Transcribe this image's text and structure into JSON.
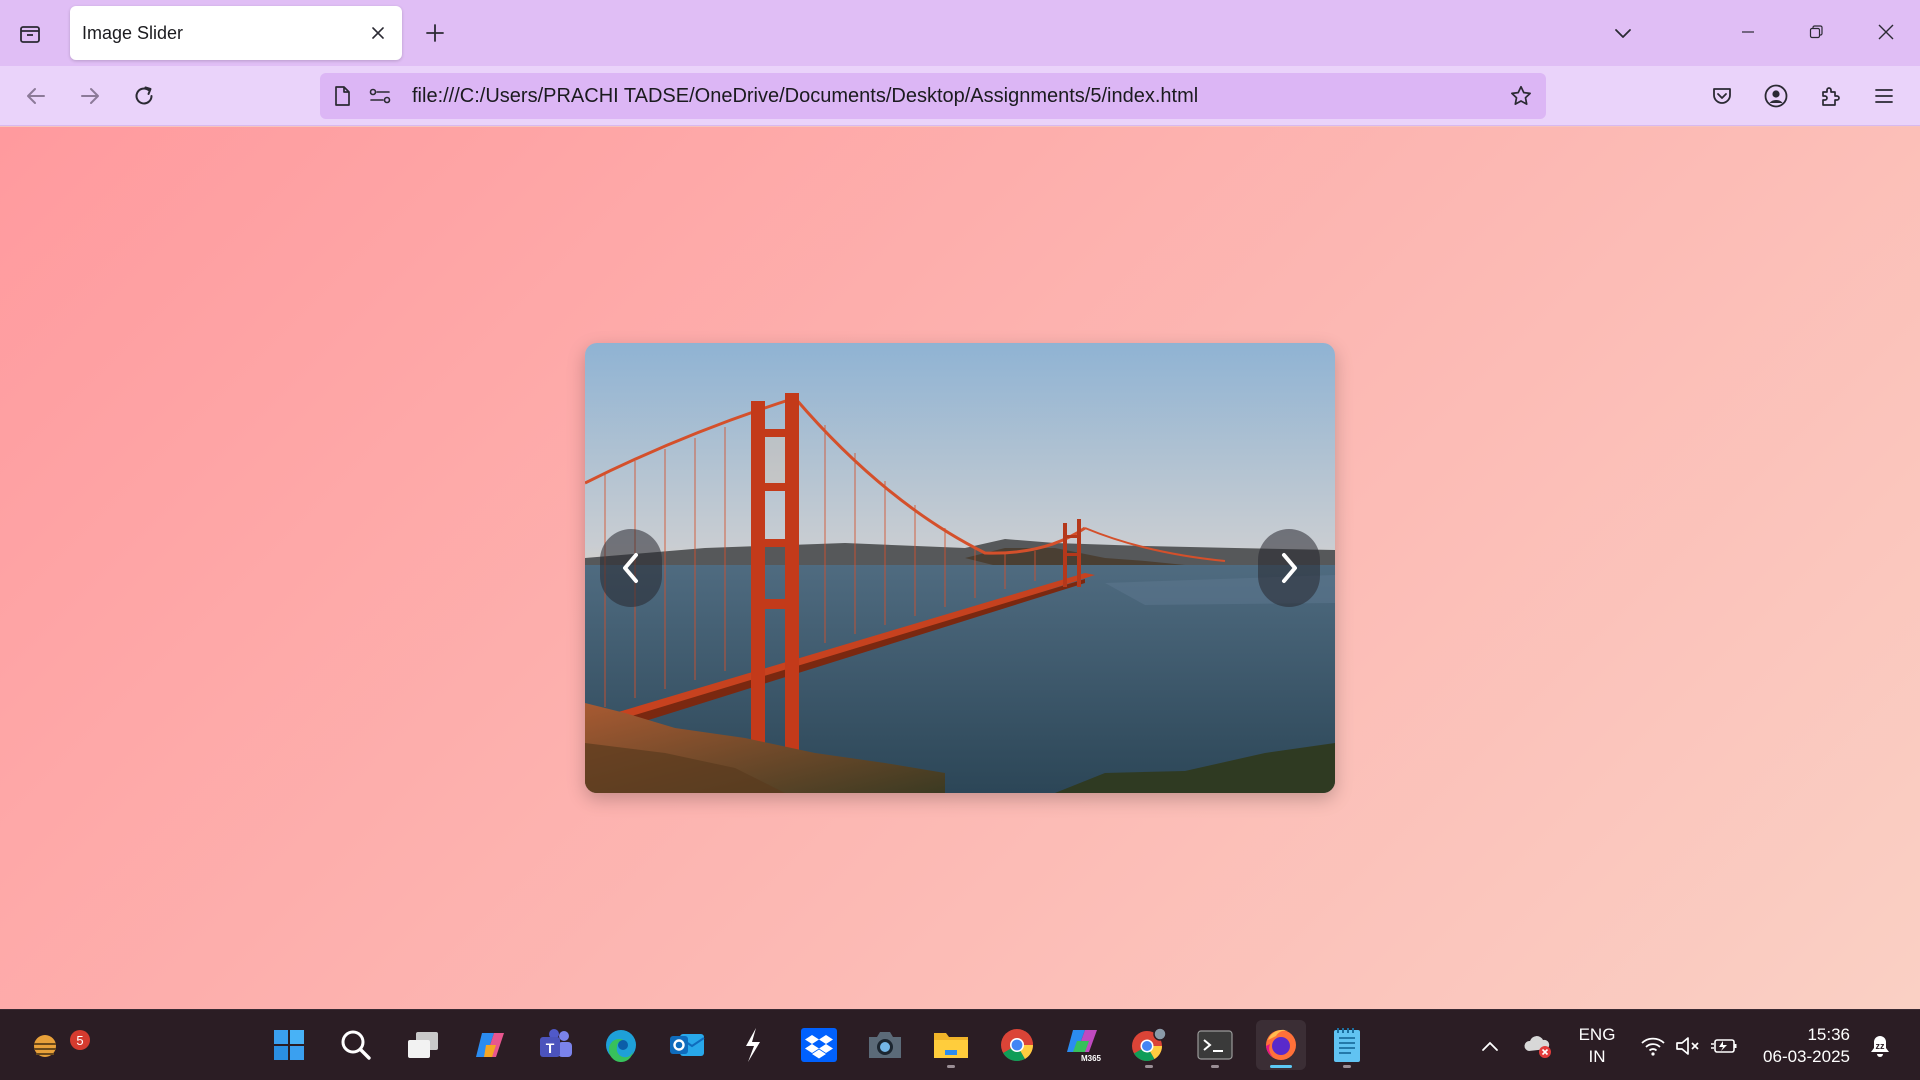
{
  "browser": {
    "tab": {
      "title": "Image Slider"
    },
    "address_bar": {
      "url": "file:///C:/Users/PRACHI TADSE/OneDrive/Documents/Desktop/Assignments/5/index.html"
    }
  },
  "page": {
    "slider": {
      "prev_label": "‹",
      "next_label": "›",
      "background_gradient": [
        "#ff9a9e",
        "#fad0c4"
      ],
      "image_subject": "golden-gate-bridge"
    }
  },
  "taskbar": {
    "weather_badge": "5",
    "pinned_apps": [
      "start",
      "search",
      "task-view",
      "copilot",
      "teams",
      "edge",
      "outlook",
      "app-bolt",
      "dropbox",
      "camera",
      "file-explorer",
      "chrome",
      "microsoft-365",
      "chrome-profile",
      "terminal",
      "firefox",
      "notepad"
    ],
    "input_language": {
      "line1": "ENG",
      "line2": "IN"
    },
    "clock": {
      "time": "15:36",
      "date": "06-03-2025"
    }
  },
  "colors": {
    "tabbar": "#e0bef5",
    "navbar": "#ead3fa",
    "taskbar": "#2b1d24",
    "accent": "#5cc9f5"
  }
}
